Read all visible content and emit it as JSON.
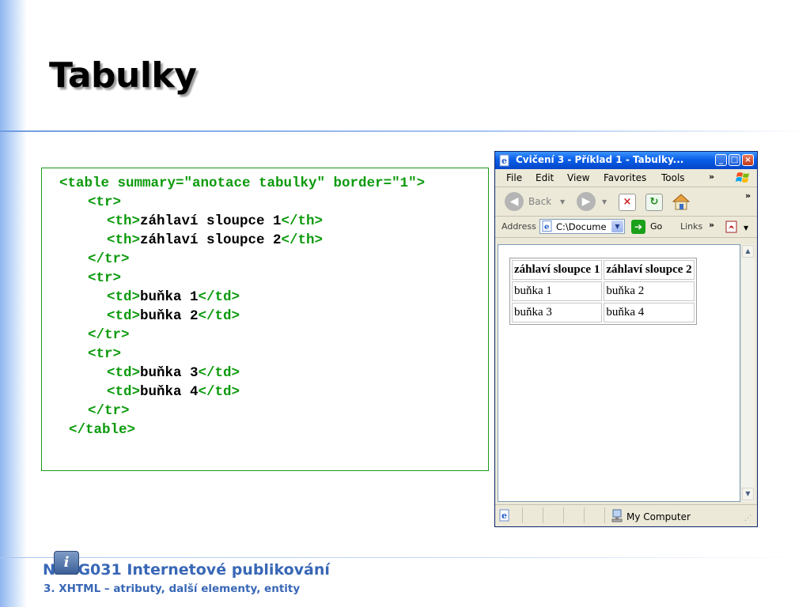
{
  "slide": {
    "title": "Tabulky"
  },
  "code": {
    "lines": [
      [
        {
          "t": "tag",
          "v": "<table summary=\"anotace tabulky\" border=\"1\">"
        }
      ],
      [
        {
          "t": "tag",
          "v": "<tr>"
        }
      ],
      [
        {
          "t": "tag",
          "v": "<th>"
        },
        {
          "t": "txt",
          "v": "záhlaví sloupce 1"
        },
        {
          "t": "tag",
          "v": "</th>"
        }
      ],
      [
        {
          "t": "tag",
          "v": "<th>"
        },
        {
          "t": "txt",
          "v": "záhlaví sloupce 2"
        },
        {
          "t": "tag",
          "v": "</th>"
        }
      ],
      [
        {
          "t": "tag",
          "v": "</tr>"
        }
      ],
      [
        {
          "t": "tag",
          "v": "<tr>"
        }
      ],
      [
        {
          "t": "tag",
          "v": "<td>"
        },
        {
          "t": "txt",
          "v": "buňka 1"
        },
        {
          "t": "tag",
          "v": "</td>"
        }
      ],
      [
        {
          "t": "tag",
          "v": "<td>"
        },
        {
          "t": "txt",
          "v": "buňka 2"
        },
        {
          "t": "tag",
          "v": "</td>"
        }
      ],
      [
        {
          "t": "tag",
          "v": "</tr>"
        }
      ],
      [
        {
          "t": "tag",
          "v": "<tr>"
        }
      ],
      [
        {
          "t": "tag",
          "v": "<td>"
        },
        {
          "t": "txt",
          "v": "buňka 3"
        },
        {
          "t": "tag",
          "v": "</td>"
        }
      ],
      [
        {
          "t": "tag",
          "v": "<td>"
        },
        {
          "t": "txt",
          "v": "buňka 4"
        },
        {
          "t": "tag",
          "v": "</td>"
        }
      ],
      [
        {
          "t": "tag",
          "v": "</tr>"
        }
      ],
      [
        {
          "t": "tag",
          "v": "</table>"
        }
      ]
    ]
  },
  "browser": {
    "title": "Cvičení 3 - Příklad 1 - Tabulky...",
    "menu": [
      "File",
      "Edit",
      "View",
      "Favorites",
      "Tools"
    ],
    "toolbar": {
      "back_label": "Back"
    },
    "address": {
      "label": "Address",
      "value": "C:\\Docume",
      "go_label": "Go",
      "links_label": "Links"
    },
    "status": {
      "zone_label": "My Computer"
    },
    "table": {
      "headers": [
        "záhlaví sloupce 1",
        "záhlaví sloupce 2"
      ],
      "rows": [
        [
          "buňka 1",
          "buňka 2"
        ],
        [
          "buňka 3",
          "buňka 4"
        ]
      ]
    }
  },
  "footer": {
    "course": "NPRG031 Internetové publikování",
    "lecture": "3. XHTML – atributy, další elementy, entity"
  },
  "colors": {
    "code_tag": "#0b9a0b",
    "code_box_border": "#1a9a1a",
    "footer_text": "#3867b6",
    "titlebar": "#0a5ee8"
  }
}
